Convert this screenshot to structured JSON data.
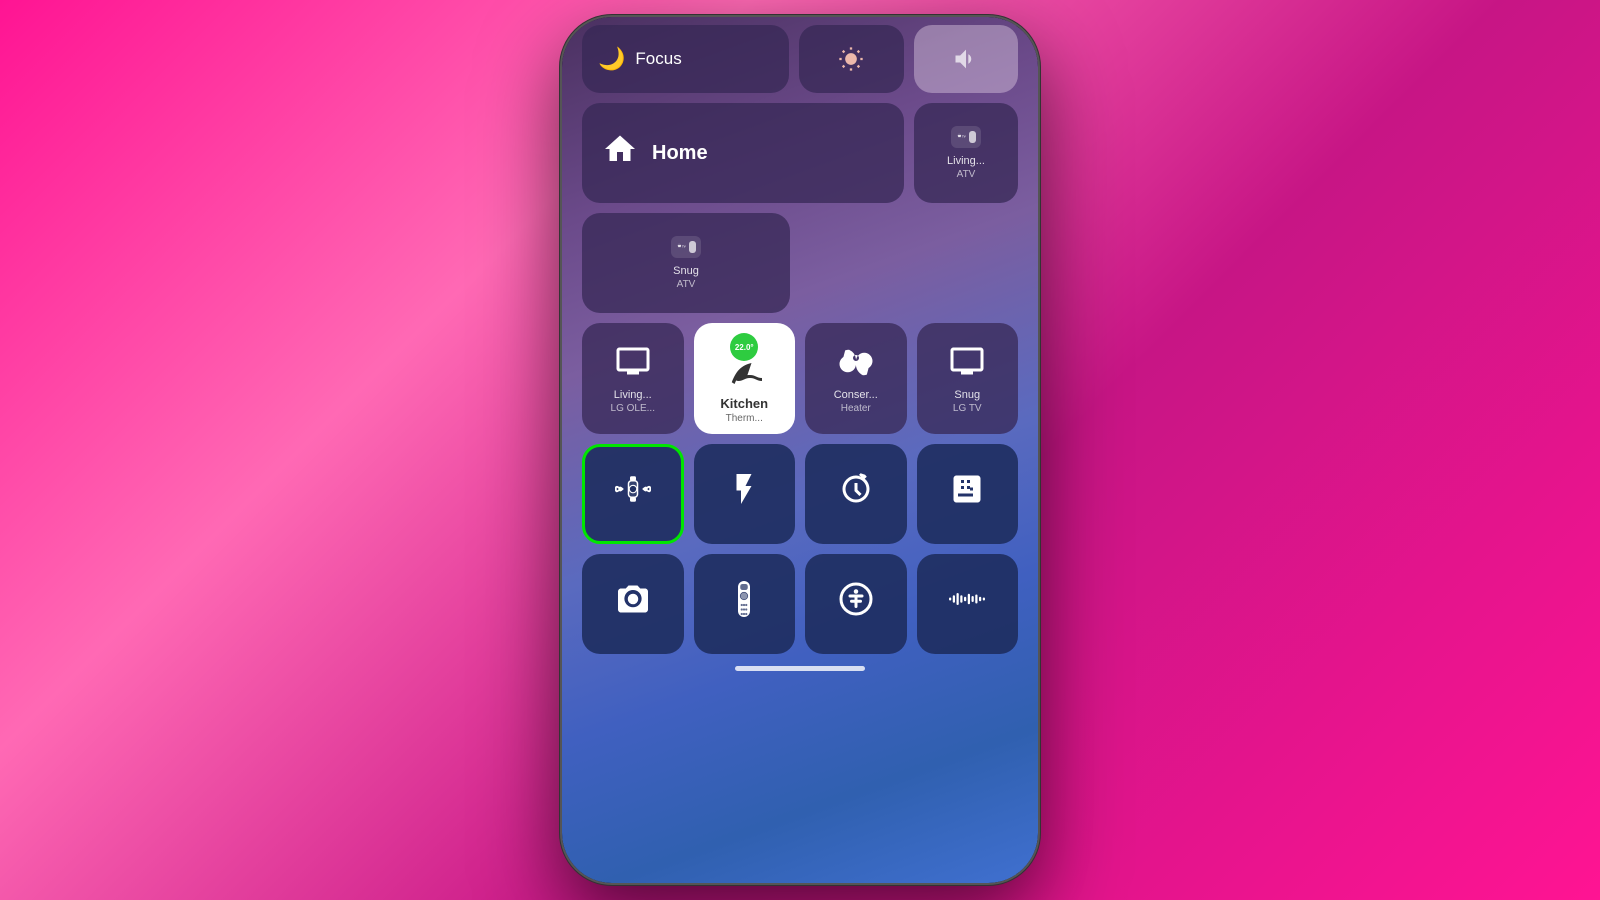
{
  "background": {
    "color_left": "#ff1493",
    "color_right": "#d63384"
  },
  "phone": {
    "top_row": {
      "focus_label": "Focus",
      "crescent_icon": "🌙"
    },
    "row1": {
      "home_label": "Home",
      "living_atv_line1": "Living...",
      "living_atv_line2": "ATV",
      "snug_atv_line1": "Snug",
      "snug_atv_line2": "ATV"
    },
    "row2": {
      "living_lg_line1": "Living...",
      "living_lg_line2": "LG OLE...",
      "kitchen_therm_line1": "Kitchen",
      "kitchen_therm_line2": "Therm...",
      "temp_value": "22.0°",
      "conserv_heater_line1": "Conser...",
      "conserv_heater_line2": "Heater",
      "snug_lg_line1": "Snug",
      "snug_lg_line2": "LG TV"
    },
    "row3": {
      "watch_ping_label": "",
      "torch_label": "",
      "timer_label": "",
      "calculator_label": ""
    },
    "row4": {
      "camera_label": "",
      "remote_label": "",
      "accessibility_label": "",
      "soundcheck_label": ""
    }
  }
}
